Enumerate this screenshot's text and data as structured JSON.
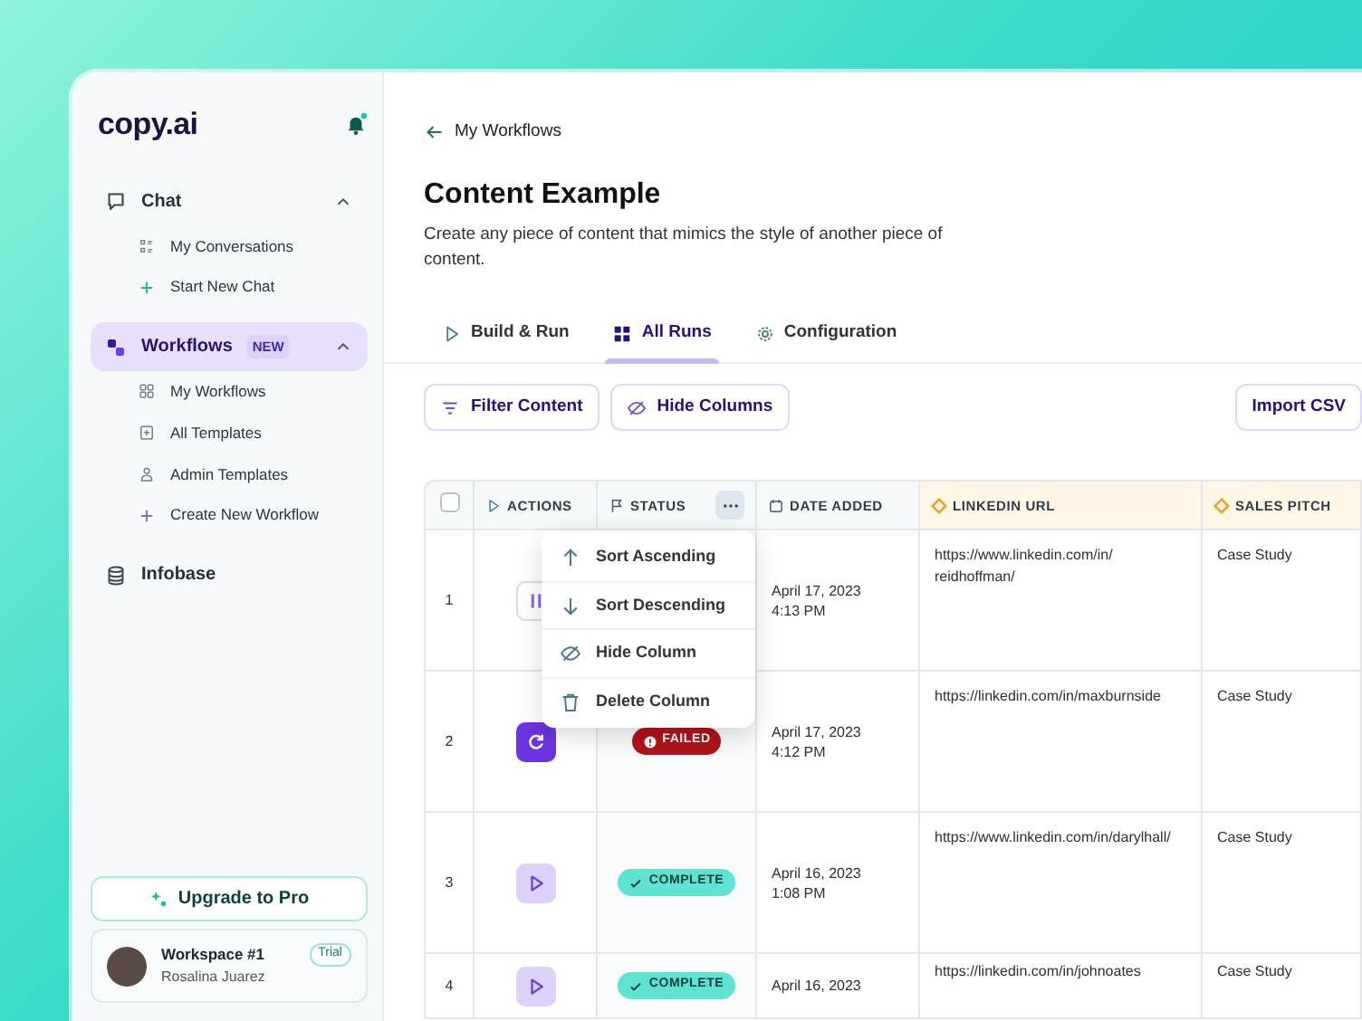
{
  "sidebar": {
    "logo": "copy.ai",
    "nav": [
      {
        "label": "Chat",
        "selected": false,
        "expanded": true,
        "children": [
          {
            "label": "My Conversations"
          },
          {
            "label": "Start New Chat"
          }
        ]
      },
      {
        "label": "Workflows",
        "badge": "NEW",
        "selected": true,
        "expanded": true,
        "children": [
          {
            "label": "My Workflows"
          },
          {
            "label": "All Templates"
          },
          {
            "label": "Admin Templates"
          },
          {
            "label": "Create New Workflow"
          }
        ]
      },
      {
        "label": "Infobase",
        "selected": false
      }
    ],
    "upgrade_button": "Upgrade to Pro",
    "workspace": {
      "name": "Workspace #1",
      "user": "Rosalina Juarez",
      "badge": "Trial"
    }
  },
  "main": {
    "back_link": "My Workflows",
    "title": "Content Example",
    "description": "Create any piece of content that mimics the style of another piece of content.",
    "tabs": [
      {
        "label": "Build & Run",
        "selected": false
      },
      {
        "label": "All Runs",
        "selected": true
      },
      {
        "label": "Configuration",
        "selected": false
      }
    ],
    "toolbar": [
      {
        "label": "Filter Content"
      },
      {
        "label": "Hide Columns"
      }
    ],
    "import_button": "Import CSV",
    "table": {
      "select_all": {
        "checked": false
      },
      "columns": [
        {
          "label": "ACTIONS",
          "kind": "plain"
        },
        {
          "label": "STATUS",
          "kind": "plain",
          "menu_open": true
        },
        {
          "label": "DATE ADDED",
          "kind": "plain"
        },
        {
          "label": "LINKEDIN URL",
          "kind": "input"
        },
        {
          "label": "SALES PITCH",
          "kind": "input"
        }
      ],
      "rows": [
        {
          "number": "1",
          "action": {
            "kind": "pause"
          },
          "date": "April 17, 2023",
          "time": "4:13 PM",
          "linkedin_url": "https://www.linkedin.com/in/reidhoffman/",
          "sales_pitch": "Case Study"
        },
        {
          "number": "2",
          "action": {
            "kind": "retry"
          },
          "status": {
            "kind": "failed",
            "label": "FAILED"
          },
          "date": "April 17, 2023",
          "time": "4:12 PM",
          "linkedin_url": "https://linkedin.com/in/maxburnside",
          "sales_pitch": "Case Study"
        },
        {
          "number": "3",
          "action": {
            "kind": "play"
          },
          "status": {
            "kind": "complete",
            "label": "COMPLETE"
          },
          "date": "April 16, 2023",
          "time": "1:08 PM",
          "linkedin_url": "https://www.linkedin.com/in/darylhall/",
          "sales_pitch": "Case Study"
        },
        {
          "number": "4",
          "action": {
            "kind": "play"
          },
          "status": {
            "kind": "complete",
            "label": "COMPLETE"
          },
          "date": "April 16, 2023",
          "linkedin_url": "https://linkedin.com/in/johnoates",
          "sales_pitch": "Case Study"
        }
      ],
      "column_menu": {
        "items": [
          {
            "label": "Sort Ascending"
          },
          {
            "label": "Sort Descending"
          },
          {
            "label": "Hide Column"
          },
          {
            "label": "Delete Column"
          }
        ]
      }
    }
  }
}
